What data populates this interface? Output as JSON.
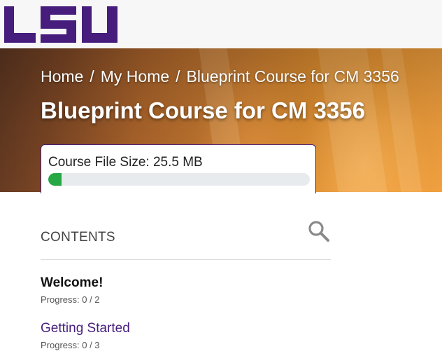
{
  "brand": {
    "logo_text": "LSU",
    "logo_color": "#461d7c"
  },
  "breadcrumb": {
    "items": [
      "Home",
      "My Home",
      "Blueprint Course for CM 3356"
    ],
    "separator": "/"
  },
  "course": {
    "title": "Blueprint Course for CM 3356"
  },
  "file_size": {
    "label": "Course File Size: 25.5 MB",
    "usage_fraction": 0.05,
    "bar_color": "#28a745"
  },
  "contents": {
    "heading": "CONTENTS",
    "search_icon": "search-icon",
    "modules": [
      {
        "title": "Welcome!",
        "progress": "Progress: 0 / 2"
      },
      {
        "title": "Getting Started",
        "progress": "Progress: 0 / 3"
      }
    ]
  },
  "colors": {
    "accent": "#461d7c",
    "hero_orange": "#e89634"
  }
}
